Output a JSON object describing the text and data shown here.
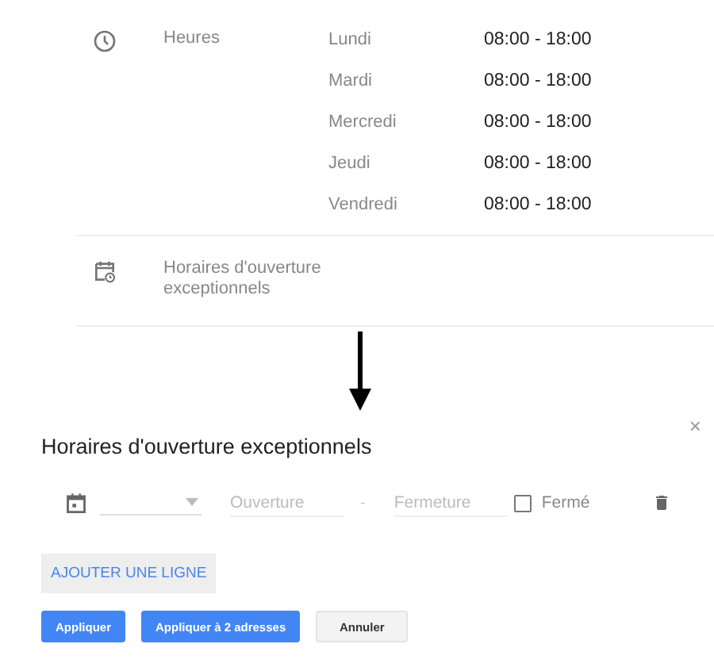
{
  "hours": {
    "label": "Heures",
    "days": [
      {
        "day": "Lundi",
        "time": "08:00 - 18:00"
      },
      {
        "day": "Mardi",
        "time": "08:00 - 18:00"
      },
      {
        "day": "Mercredi",
        "time": "08:00 - 18:00"
      },
      {
        "day": "Jeudi",
        "time": "08:00 - 18:00"
      },
      {
        "day": "Vendredi",
        "time": "08:00 - 18:00"
      }
    ]
  },
  "special_hours": {
    "label": "Horaires d'ouverture exceptionnels"
  },
  "dialog": {
    "title": "Horaires d'ouverture exceptionnels",
    "close": "×",
    "row": {
      "open_placeholder": "Ouverture",
      "separator": "-",
      "close_placeholder": "Fermeture",
      "closed_label": "Fermé",
      "closed": false
    },
    "add_line": "AJOUTER UNE LIGNE",
    "buttons": [
      {
        "label": "Appliquer",
        "kind": "primary"
      },
      {
        "label": "Appliquer à 2 adresses",
        "kind": "primary"
      },
      {
        "label": "Annuler",
        "kind": "secondary"
      }
    ]
  }
}
